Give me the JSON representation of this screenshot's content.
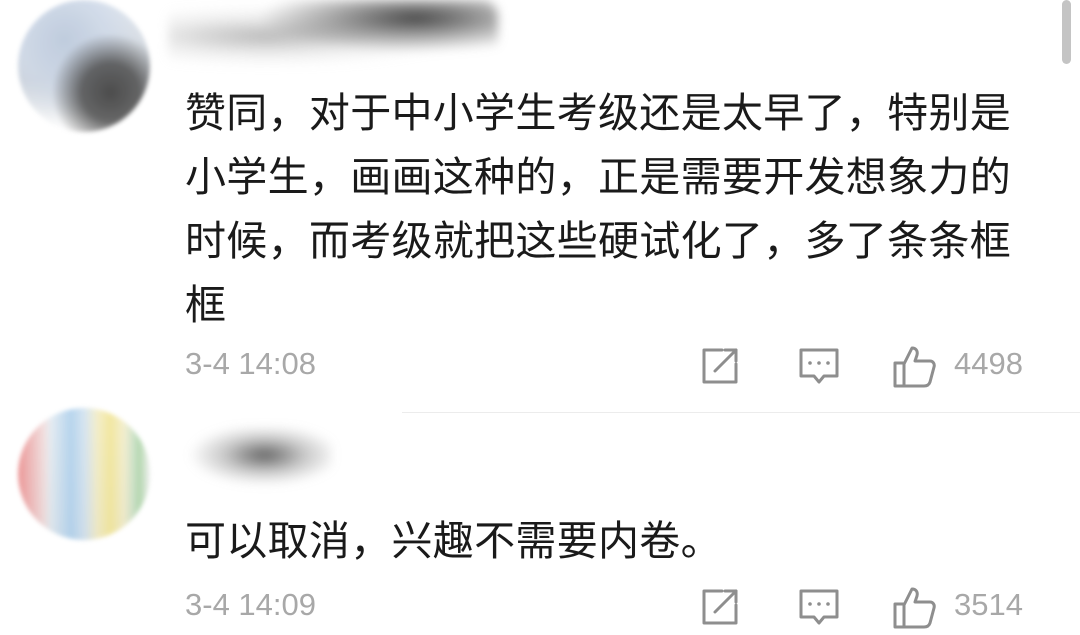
{
  "comments": [
    {
      "text": "赞同，对于中小学生考级还是太早了，特别是小学生，画画这种的，正是需要开发想象力的时候，而考级就把这些硬试化了，多了条条框框",
      "time": "3-4 14:08",
      "likes": "4498"
    },
    {
      "text": "可以取消，兴趣不需要内卷。",
      "time": "3-4 14:09",
      "likes": "3514"
    }
  ],
  "icons": {
    "share": "share-icon",
    "reply": "comment-icon",
    "like": "thumbs-up-icon"
  },
  "colors": {
    "text": "#1a1a1a",
    "meta": "#a8a8a8",
    "icon": "#8e8e8e"
  }
}
